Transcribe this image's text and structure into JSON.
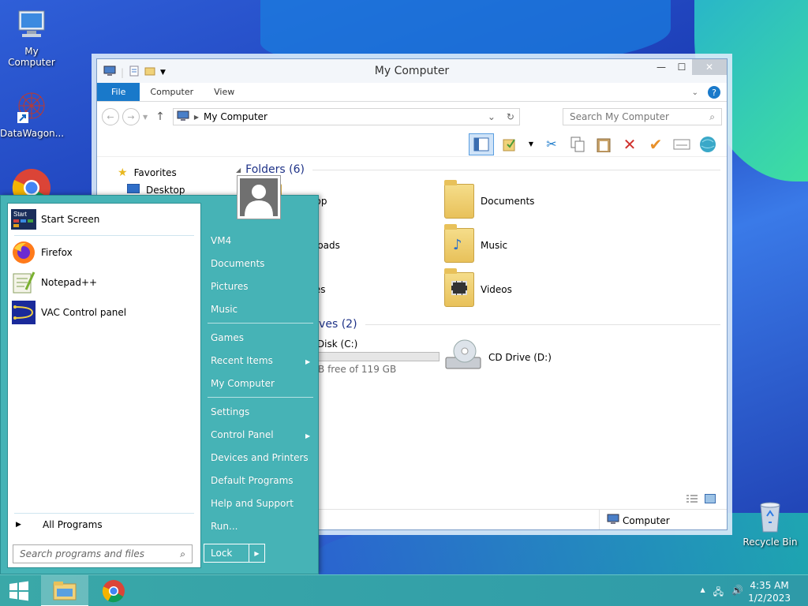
{
  "desktop": {
    "icons": [
      {
        "label": "My Computer",
        "icon": "computer-icon"
      },
      {
        "label": "DataWagon...",
        "icon": "shortcut-icon"
      },
      {
        "label": "Recycle Bin",
        "icon": "recycle-bin-icon"
      }
    ]
  },
  "window": {
    "title": "My Computer",
    "tabs": [
      "File",
      "Computer",
      "View"
    ],
    "address": "My Computer",
    "search_placeholder": "Search My Computer",
    "nav": {
      "favorites": "Favorites",
      "desktop": "Desktop"
    },
    "groups": {
      "folders": "Folders (6)",
      "drives": "Hard Disk Drives (2)"
    },
    "folders": [
      "Desktop",
      "Documents",
      "Downloads",
      "Music",
      "Pictures",
      "Videos"
    ],
    "drives": [
      {
        "name": "Local Disk (C:)",
        "free": "100 GB free of 119 GB",
        "used_fraction": 0.16
      },
      {
        "name": "CD Drive (D:)"
      }
    ],
    "status": "Computer"
  },
  "start": {
    "programs": [
      "Start Screen",
      "Firefox",
      "Notepad++",
      "VAC Control panel"
    ],
    "all_programs": "All Programs",
    "search_placeholder": "Search programs and files",
    "right": [
      "VM4",
      "Documents",
      "Pictures",
      "Music",
      "Games",
      "Recent Items",
      "My Computer",
      "Settings",
      "Control Panel",
      "Devices and Printers",
      "Default Programs",
      "Help and Support",
      "Run..."
    ],
    "lock": "Lock"
  },
  "taskbar": {
    "time": "4:35 AM",
    "date": "1/2/2023"
  },
  "colors": {
    "start_accent": "#46b3b6",
    "file_tab": "#1979ca",
    "group_text": "#1e3287"
  }
}
